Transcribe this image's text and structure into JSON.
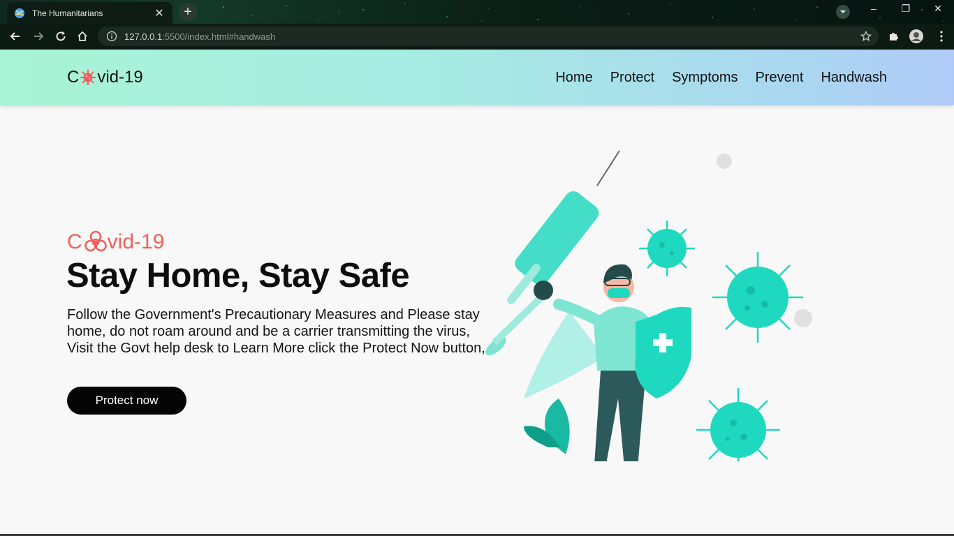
{
  "browser": {
    "tab_title": "The Humanitarians",
    "close_glyph": "✕",
    "new_tab_glyph": "+",
    "url_host": "127.0.0.1",
    "url_rest": ":5500/index.html#handwash",
    "window_controls": {
      "minimize": "–",
      "restore": "❐",
      "close": "✕"
    }
  },
  "navbar": {
    "logo_pre": "C",
    "logo_post": "vid-19",
    "links": [
      "Home",
      "Protect",
      "Symptoms",
      "Prevent",
      "Handwash"
    ]
  },
  "hero": {
    "brand_pre": "C",
    "brand_post": "vid-19",
    "title": "Stay Home, Stay Safe",
    "text": "Follow the Government's Precautionary Measures and Please stay home, do not roam around and be a carrier transmitting the virus, Visit the Govt help desk to Learn More click the Protect Now button,",
    "cta_label": "Protect now"
  },
  "colors": {
    "accent": "#f0605c",
    "virus": "#1ed9c0",
    "navbar_gradient_start": "#a8f4d6",
    "navbar_gradient_end": "#b0cbf8"
  }
}
